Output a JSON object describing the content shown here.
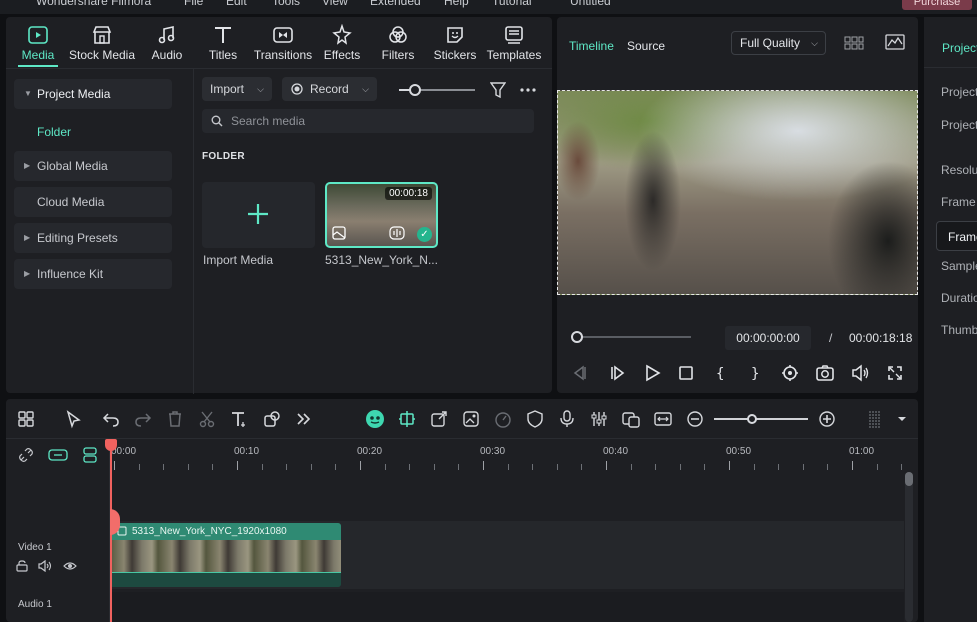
{
  "titlebar": {
    "app_name": "Wondershare Filmora",
    "menu": [
      "File",
      "Edit",
      "Tools",
      "View",
      "Extended",
      "Help",
      "Tutorial"
    ],
    "project_name": "Untitled",
    "purchase_label": "Purchase"
  },
  "media_tabs": [
    {
      "label": "Media",
      "icon": "media-icon",
      "active": true
    },
    {
      "label": "Stock Media",
      "icon": "stock-media-icon"
    },
    {
      "label": "Audio",
      "icon": "audio-icon"
    },
    {
      "label": "Titles",
      "icon": "titles-icon"
    },
    {
      "label": "Transitions",
      "icon": "transitions-icon"
    },
    {
      "label": "Effects",
      "icon": "effects-icon"
    },
    {
      "label": "Filters",
      "icon": "filters-icon"
    },
    {
      "label": "Stickers",
      "icon": "stickers-icon"
    },
    {
      "label": "Templates",
      "icon": "templates-icon"
    }
  ],
  "sidebar": {
    "items": [
      {
        "label": "Project Media",
        "expanded": true
      },
      {
        "label": "Global Media"
      },
      {
        "label": "Cloud Media"
      },
      {
        "label": "Editing Presets"
      },
      {
        "label": "Influence Kit"
      }
    ],
    "folder_label": "Folder"
  },
  "media_toolbar": {
    "import_label": "Import",
    "record_label": "Record",
    "search_placeholder": "Search media"
  },
  "folder_heading": "FOLDER",
  "tiles": {
    "import_label": "Import Media",
    "clip_name": "5313_New_York_N...",
    "clip_duration": "00:00:18"
  },
  "player": {
    "tab_timeline": "Timeline",
    "tab_source": "Source",
    "quality": "Full Quality",
    "current_time": "00:00:00:00",
    "separator": "/",
    "total_time": "00:00:18:18"
  },
  "properties": {
    "tab": "Project",
    "labels": [
      "Project",
      "Project Location",
      "Resolution",
      "Frame Rate",
      "Frame",
      "Sample",
      "Duration",
      "Thumbnail"
    ]
  },
  "timeline": {
    "ruler_labels": [
      "00:00",
      "00:10",
      "00:20",
      "00:30",
      "00:40",
      "00:50",
      "01:00"
    ],
    "tracks": [
      {
        "label": "Video 1"
      },
      {
        "label": "Audio 1"
      }
    ],
    "clip_name": "5313_New_York_NYC_1920x1080"
  },
  "colors": {
    "accent": "#5ee8c6",
    "clip_header": "#2f8a73",
    "playhead": "#f0625f",
    "purchase": "#7a3b4a"
  }
}
